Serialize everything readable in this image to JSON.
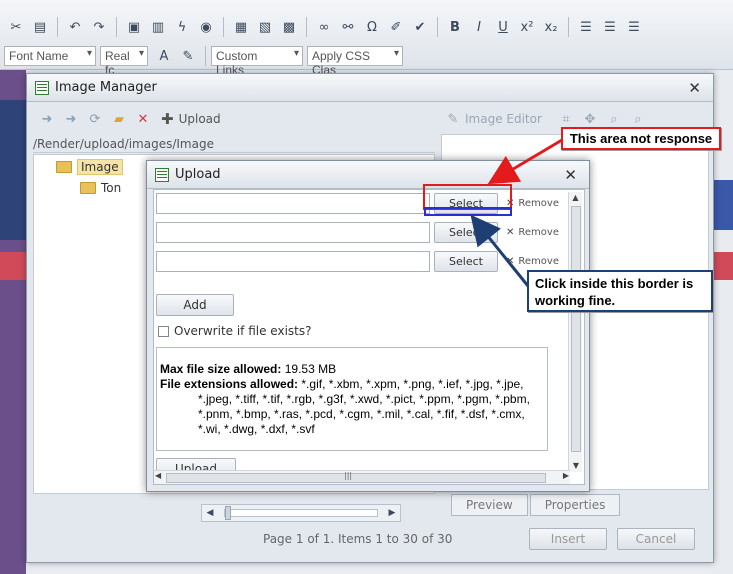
{
  "editor_toolbar": {
    "font_name_placeholder": "Font Name",
    "font_size_placeholder": "Real fc",
    "custom_links_placeholder": "Custom Links",
    "css_class_placeholder": "Apply CSS Clas",
    "bold_label": "B",
    "italic_label": "I",
    "underline_label": "U",
    "superscript_label": "x²",
    "subscript_label": "x₂",
    "font_color_label": "A"
  },
  "image_manager": {
    "title": "Image Manager",
    "toolbar": {
      "upload_label": "Upload",
      "image_editor_label": "Image Editor"
    },
    "path": "/Render/upload/images/Image",
    "tree": [
      {
        "label": "Image",
        "selected": true
      },
      {
        "label": "Ton",
        "selected": false
      }
    ],
    "tabs": [
      "Preview",
      "Properties"
    ],
    "insert_label": "Insert",
    "cancel_label": "Cancel",
    "pager_text": "Page 1 of 1. Items 1 to 30 of 30"
  },
  "upload_dialog": {
    "title": "Upload",
    "rows": [
      {
        "select_label": "Select",
        "remove_label": "Remove"
      },
      {
        "select_label": "Select",
        "remove_label": "Remove"
      },
      {
        "select_label": "Select",
        "remove_label": "Remove"
      }
    ],
    "add_label": "Add",
    "overwrite_label": "Overwrite if file exists?",
    "max_size_label": "Max file size allowed:",
    "max_size_value": "19.53 MB",
    "extensions_label": "File extensions allowed:",
    "extensions_first_line": "*.gif, *.xbm, *.xpm, *.png, *.ief, *.jpg, *.jpe,",
    "extensions_lines": [
      "*.jpeg, *.tiff, *.tif, *.rgb, *.g3f, *.xwd, *.pict, *.ppm, *.pgm, *.pbm,",
      "*.pnm, *.bmp, *.ras, *.pcd, *.cgm, *.mil, *.cal, *.fif, *.dsf, *.cmx,",
      "*.wi, *.dwg, *.dxf, *.svf"
    ],
    "upload_label": "Upload"
  },
  "annotations": {
    "red_callout": "This area not response",
    "blue_callout": "Click inside this border is working fine.",
    "red_color": "#e31b1b",
    "blue_color": "#1d3f73"
  }
}
